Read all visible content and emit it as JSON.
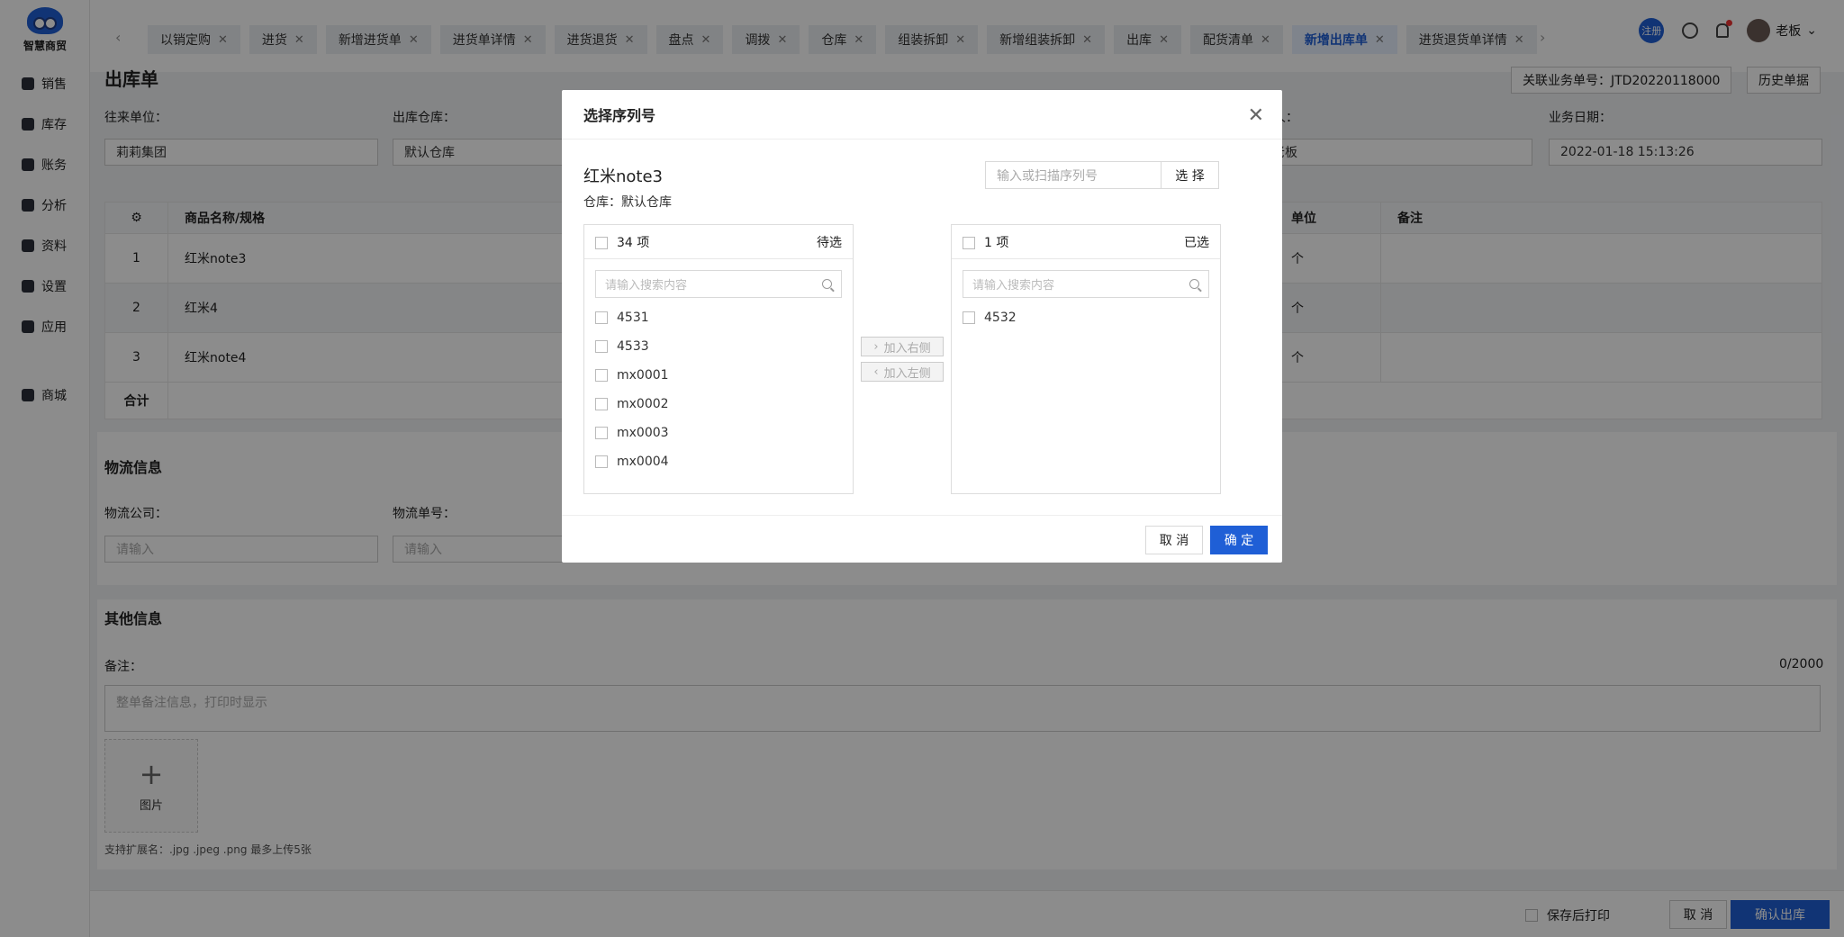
{
  "brand": {
    "name": "智慧商贸"
  },
  "nav": [
    {
      "label": "销售",
      "icon": "store-icon"
    },
    {
      "label": "库存",
      "icon": "inventory-icon"
    },
    {
      "label": "账务",
      "icon": "wallet-icon"
    },
    {
      "label": "分析",
      "icon": "chart-icon"
    },
    {
      "label": "资料",
      "icon": "box-icon"
    },
    {
      "label": "设置",
      "icon": "gear-icon"
    },
    {
      "label": "应用",
      "icon": "apps-icon"
    },
    {
      "label": "商城",
      "icon": "shop-bag-icon"
    }
  ],
  "tabs": [
    {
      "label": "以销定购",
      "active": false
    },
    {
      "label": "进货",
      "active": false
    },
    {
      "label": "新增进货单",
      "active": false
    },
    {
      "label": "进货单详情",
      "active": false
    },
    {
      "label": "进货退货",
      "active": false
    },
    {
      "label": "盘点",
      "active": false
    },
    {
      "label": "调拨",
      "active": false
    },
    {
      "label": "仓库",
      "active": false
    },
    {
      "label": "组装拆卸",
      "active": false
    },
    {
      "label": "新增组装拆卸",
      "active": false
    },
    {
      "label": "出库",
      "active": false
    },
    {
      "label": "配货清单",
      "active": false
    },
    {
      "label": "新增出库单",
      "active": true
    },
    {
      "label": "进货退货单详情",
      "active": false
    }
  ],
  "header": {
    "register_badge": "注册",
    "user_name": "老板"
  },
  "page": {
    "title": "出库单",
    "related_no": "关联业务单号：JTD20220118000",
    "history_button": "历史单据",
    "partner_label": "往来单位：",
    "partner_value": "莉莉集团",
    "warehouse_label": "出库仓库：",
    "warehouse_value": "默认仓库",
    "handler_label": "人：",
    "handler_value": "老板",
    "date_label": "业务日期：",
    "date_value": "2022-01-18 15:13:26"
  },
  "table": {
    "headers": {
      "name": "商品名称/规格",
      "unit": "单位",
      "note": "备注"
    },
    "rows": [
      {
        "no": "1",
        "name": "红米note3",
        "unit": "个"
      },
      {
        "no": "2",
        "name": "红米4",
        "unit": "个"
      },
      {
        "no": "3",
        "name": "红米note4",
        "unit": "个"
      }
    ],
    "total_label": "合计"
  },
  "logistics": {
    "title": "物流信息",
    "company_label": "物流公司：",
    "company_placeholder": "请输入",
    "no_label": "物流单号：",
    "no_placeholder": "请输入"
  },
  "other": {
    "title": "其他信息",
    "note_label": "备注：",
    "note_count": "0/2000",
    "note_placeholder": "整单备注信息，打印时显示",
    "image_label": "图片",
    "image_hint": "支持扩展名：.jpg .jpeg .png 最多上传5张"
  },
  "footer": {
    "print_after_save": "保存后打印",
    "cancel": "取 消",
    "confirm": "确认出库"
  },
  "modal": {
    "title": "选择序列号",
    "product": "红米note3",
    "warehouse": "仓库：默认仓库",
    "scan_placeholder": "输入或扫描序列号",
    "select_button": "选 择",
    "left": {
      "count": "34 项",
      "status": "待选",
      "search_placeholder": "请输入搜索内容",
      "items": [
        "4531",
        "4533",
        "mx0001",
        "mx0002",
        "mx0003",
        "mx0004"
      ]
    },
    "right": {
      "count": "1 项",
      "status": "已选",
      "search_placeholder": "请输入搜索内容",
      "items": [
        "4532"
      ]
    },
    "to_right": "加入右侧",
    "to_left": "加入左侧",
    "cancel": "取 消",
    "ok": "确 定"
  },
  "colors": {
    "primary": "#1f5fd6",
    "overlay": "rgba(0,0,0,0.45)"
  }
}
